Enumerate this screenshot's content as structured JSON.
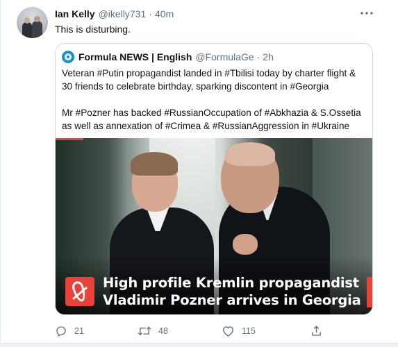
{
  "tweet": {
    "author_name": "Ian Kelly",
    "author_handle": "@ikelly731",
    "separator": "·",
    "time": "40m",
    "text": "This is disturbing."
  },
  "quoted_tweet": {
    "author_name": "Formula NEWS | English",
    "author_handle": "@FormulaGe",
    "separator": "·",
    "time": "2h",
    "lines": [
      "Veteran #Putin propagandist landed in #Tbilisi today by charter flight &",
      "30 friends to celebrate birthday, sparking discontent in #Georgia",
      "",
      "Mr #Pozner has backed #RussianOccupation of #Abkhazia & S.Ossetia",
      "as well as annexation of #Crimea & #RussianAggression in #Ukraine"
    ],
    "image_banner": [
      "High profile Kremlin propagandist",
      "Vladimir Pozner arrives in Georgia"
    ]
  },
  "actions": {
    "reply_count": "21",
    "retweet_count": "48",
    "like_count": "115"
  },
  "icons": {
    "more": "more-dots-icon",
    "reply": "reply-icon",
    "retweet": "retweet-icon",
    "like": "heart-icon",
    "share": "share-icon",
    "news_logo": "formula-logo-icon",
    "banner_logo": "formula-banner-logo"
  },
  "colors": {
    "text": "#0f1419",
    "secondary": "#5b7083",
    "border": "#cfd9de",
    "brand_red": "#e8433a",
    "brand_blue": "#1b8fd6"
  }
}
